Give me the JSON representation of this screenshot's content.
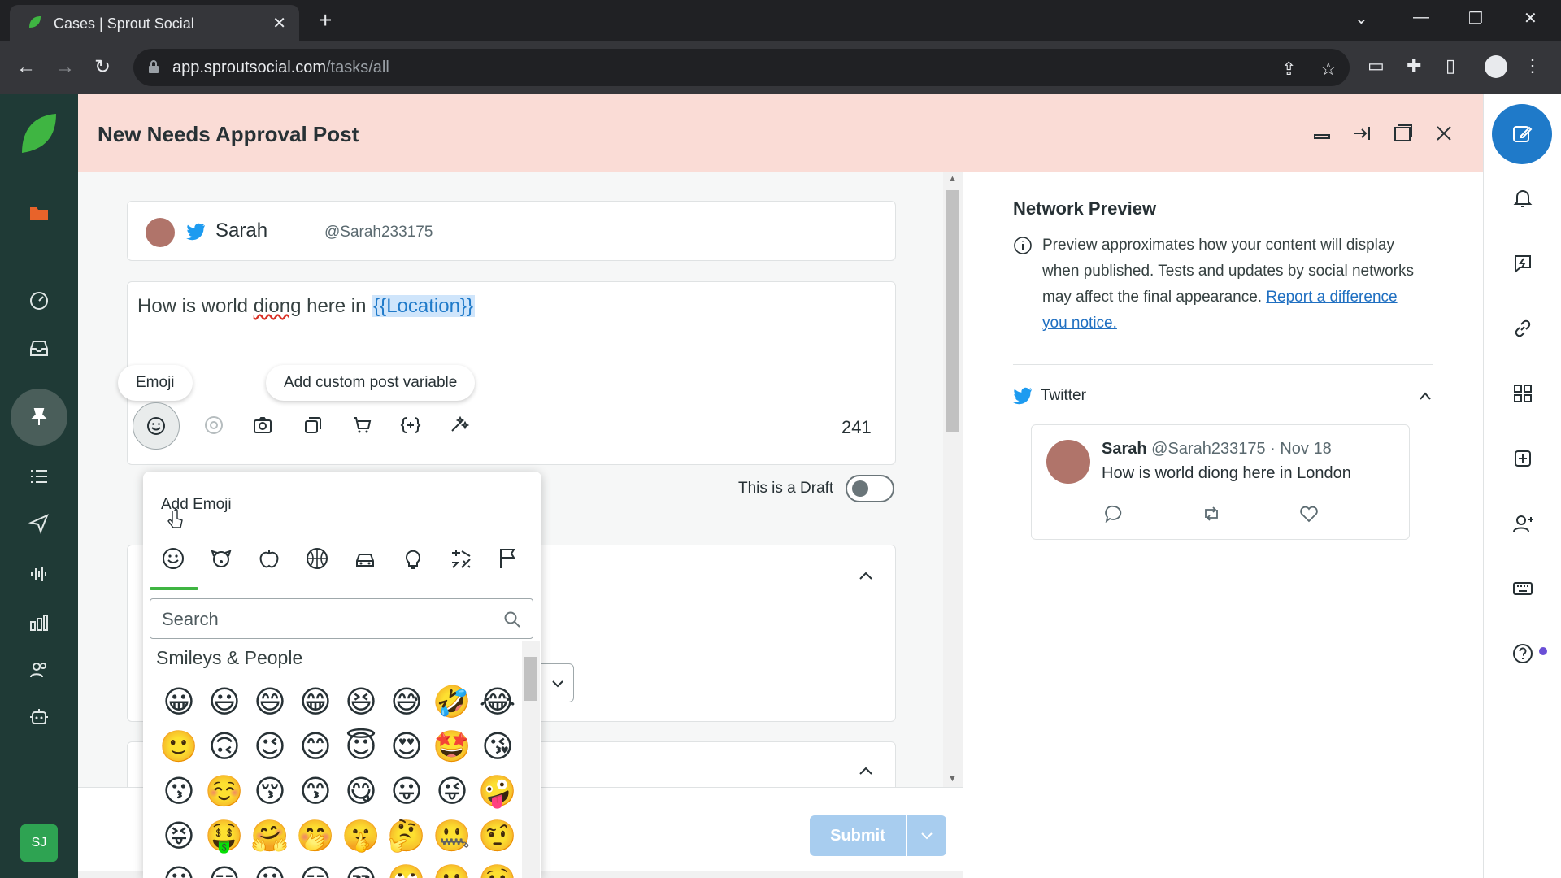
{
  "browser": {
    "tab_title": "Cases | Sprout Social",
    "url_host": "app.sproutsocial.com",
    "url_path": "/tasks/all"
  },
  "leftnav": {
    "avatar_initials": "SJ",
    "items": [
      "folder-icon",
      "gauge-icon",
      "inbox-icon",
      "pin-icon",
      "list-icon",
      "send-icon",
      "listening-icon",
      "reports-icon",
      "people-icon",
      "bot-icon"
    ],
    "active": "pin-icon",
    "brand_color": "#2ea352"
  },
  "panel": {
    "title": "New Needs Approval Post",
    "header_color": "#fadcd6"
  },
  "profile": {
    "name": "Sarah",
    "handle": "@Sarah233175",
    "network": "twitter-icon"
  },
  "editor": {
    "text_before": "How is world ",
    "text_typo": "diong",
    "text_middle": " here in ",
    "text_variable": "{{Location}}",
    "tooltip_emoji": "Emoji",
    "tooltip_variable": "Add custom post variable",
    "char_count": "241",
    "draft_label": "This is a Draft",
    "draft_on": false
  },
  "footer": {
    "submit_label": "Submit"
  },
  "preview": {
    "title": "Network Preview",
    "info_text": "Preview approximates how your content will display when published. Tests and updates by social networks may affect the final appearance.",
    "report_link": "Report a difference you notice.",
    "network_label": "Twitter",
    "tweet": {
      "name": "Sarah",
      "handle": "@Sarah233175",
      "date": "Nov 18",
      "text": "How is world diong here in London"
    }
  },
  "emoji_picker": {
    "title": "Add Emoji",
    "search_placeholder": "Search",
    "section_label": "Smileys & People",
    "categories": [
      "smiley-icon",
      "animal-icon",
      "food-icon",
      "activity-icon",
      "travel-icon",
      "objects-icon",
      "symbols-icon",
      "flags-icon"
    ],
    "emojis": [
      "😀",
      "😃",
      "😄",
      "😁",
      "😆",
      "😅",
      "🤣",
      "😂",
      "🙂",
      "🙃",
      "😉",
      "😊",
      "😇",
      "😍",
      "🤩",
      "😘",
      "😗",
      "☺️",
      "😚",
      "😙",
      "😋",
      "😛",
      "😜",
      "🤪",
      "😝",
      "🤑",
      "🤗",
      "🤭",
      "🤫",
      "🤔",
      "🤐",
      "🤨",
      "😐",
      "😑",
      "😶",
      "😏",
      "😒",
      "🙄",
      "😬",
      "🤥"
    ]
  }
}
